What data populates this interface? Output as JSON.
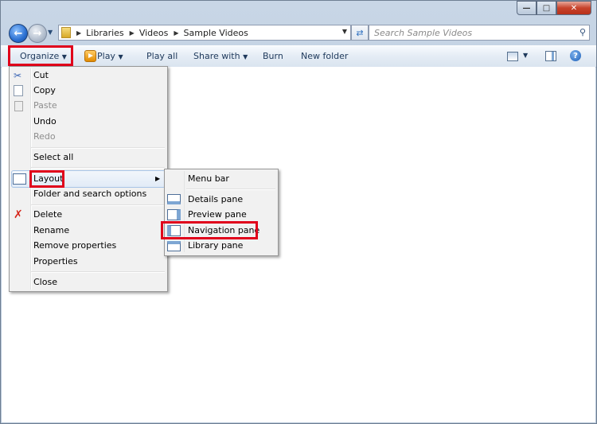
{
  "address": {
    "crumbs": [
      "Libraries",
      "Videos",
      "Sample Videos"
    ]
  },
  "search": {
    "placeholder": "Search Sample Videos"
  },
  "toolbar": {
    "organize": "Organize",
    "play": "Play",
    "play_all": "Play all",
    "share_with": "Share with",
    "burn": "Burn",
    "new_folder": "New folder"
  },
  "organize_menu": {
    "cut": "Cut",
    "copy": "Copy",
    "paste": "Paste",
    "undo": "Undo",
    "redo": "Redo",
    "select_all": "Select all",
    "layout": "Layout",
    "folder_options": "Folder and search options",
    "delete": "Delete",
    "rename": "Rename",
    "remove_properties": "Remove properties",
    "properties": "Properties",
    "close": "Close"
  },
  "layout_menu": {
    "menu_bar": "Menu bar",
    "details_pane": "Details pane",
    "preview_pane": "Preview pane",
    "navigation_pane": "Navigation pane",
    "library_pane": "Library pane"
  },
  "colors": {
    "highlight": "#e0001b",
    "toolbar_text": "#1e395b"
  }
}
